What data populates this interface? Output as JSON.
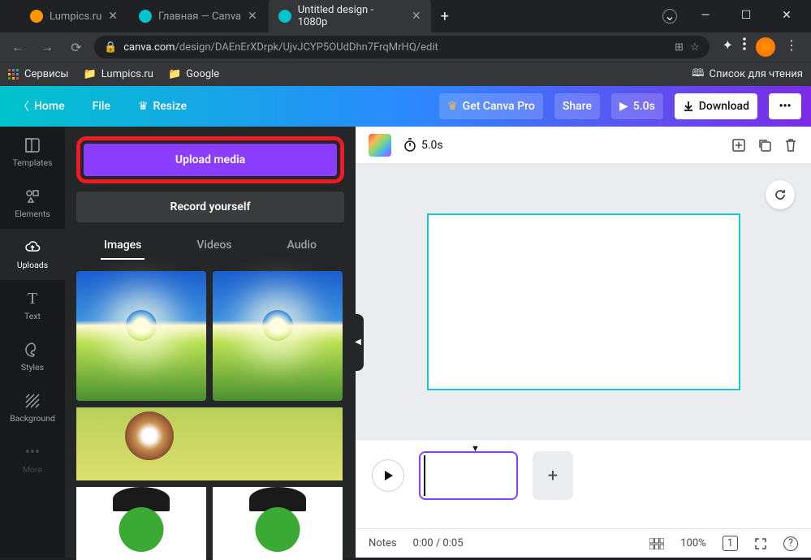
{
  "browser": {
    "tabs": [
      {
        "title": "Lumpics.ru",
        "fav_color": "#ff9500"
      },
      {
        "title": "Главная — Canva",
        "fav_color": "#00c4cc"
      },
      {
        "title": "Untitled design - 1080p",
        "fav_color": "#00c4cc"
      }
    ],
    "url_domain": "canva.com",
    "url_path": "/design/DAEnErXDrpk/UjvJCYP5OUdDhn7FrqMrHQ/edit",
    "bookmarks": {
      "services": "Сервисы",
      "lumpics": "Lumpics.ru",
      "google": "Google",
      "reading_list": "Список для чтения"
    }
  },
  "canva_top": {
    "home": "Home",
    "file": "File",
    "resize": "Resize",
    "get_pro": "Get Canva Pro",
    "share": "Share",
    "play_duration": "5.0s",
    "download": "Download"
  },
  "side_nav": {
    "templates": "Templates",
    "elements": "Elements",
    "uploads": "Uploads",
    "text": "Text",
    "styles": "Styles",
    "background": "Background",
    "more": "More"
  },
  "panel": {
    "upload_media": "Upload media",
    "record_yourself": "Record yourself",
    "tabs": {
      "images": "Images",
      "videos": "Videos",
      "audio": "Audio"
    }
  },
  "editor": {
    "duration": "5.0s"
  },
  "footer": {
    "notes": "Notes",
    "time": "0:00 / 0:05",
    "zoom": "100%",
    "page": "1"
  }
}
